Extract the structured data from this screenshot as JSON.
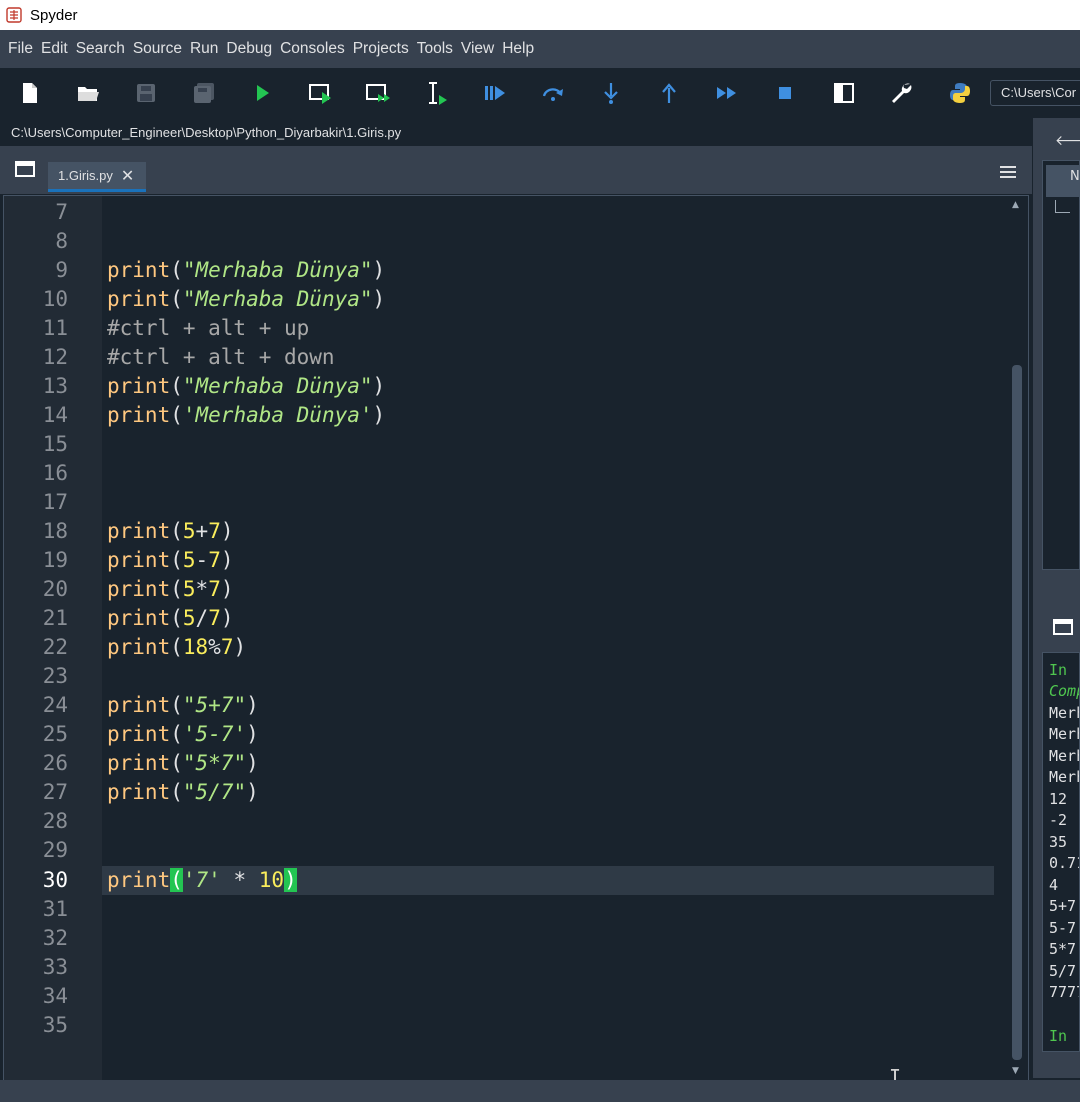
{
  "window": {
    "title": "Spyder"
  },
  "menu": [
    "File",
    "Edit",
    "Search",
    "Source",
    "Run",
    "Debug",
    "Consoles",
    "Projects",
    "Tools",
    "View",
    "Help"
  ],
  "toolbar": {
    "path_value": "C:\\Users\\Computer_Engineer",
    "path_visible": "C:\\Users\\Cor",
    "icons": [
      "new-file-icon",
      "open-file-icon",
      "save-icon",
      "save-all-icon",
      "run-icon",
      "run-cell-icon",
      "run-cell-advance-icon",
      "run-selection-icon",
      "debug-icon",
      "step-over-icon",
      "step-into-icon",
      "step-return-icon",
      "continue-icon",
      "stop-icon",
      "maximize-pane-icon",
      "preferences-icon",
      "python-path-icon"
    ]
  },
  "editor": {
    "file_path": "C:\\Users\\Computer_Engineer\\Desktop\\Python_Diyarbakir\\1.Giris.py",
    "tab_label": "1.Giris.py",
    "current_line": 30,
    "lines": [
      {
        "n": "7"
      },
      {
        "n": "8"
      },
      {
        "n": "9",
        "code": "print(\"Merhaba Dünya\")"
      },
      {
        "n": "10",
        "code": "print(\"Merhaba Dünya\")"
      },
      {
        "n": "11",
        "code": "#ctrl + alt + up"
      },
      {
        "n": "12",
        "code": "#ctrl + alt + down"
      },
      {
        "n": "13",
        "code": "print(\"Merhaba Dünya\")"
      },
      {
        "n": "14",
        "code": "print('Merhaba Dünya')"
      },
      {
        "n": "15"
      },
      {
        "n": "16"
      },
      {
        "n": "17"
      },
      {
        "n": "18",
        "code": "print(5+7)"
      },
      {
        "n": "19",
        "code": "print(5-7)"
      },
      {
        "n": "20",
        "code": "print(5*7)"
      },
      {
        "n": "21",
        "code": "print(5/7)"
      },
      {
        "n": "22",
        "code": "print(18%7)"
      },
      {
        "n": "23"
      },
      {
        "n": "24",
        "code": "print(\"5+7\")"
      },
      {
        "n": "25",
        "code": "print('5-7')"
      },
      {
        "n": "26",
        "code": "print(\"5*7\")"
      },
      {
        "n": "27",
        "code": "print(\"5/7\")"
      },
      {
        "n": "28"
      },
      {
        "n": "29"
      },
      {
        "n": "30",
        "code": "print('7' * 10)"
      },
      {
        "n": "31"
      },
      {
        "n": "32"
      },
      {
        "n": "33"
      },
      {
        "n": "34"
      },
      {
        "n": "35"
      }
    ]
  },
  "right_pane": {
    "header_fragment": "N"
  },
  "console": {
    "lines": [
      "In",
      "Comp",
      "Merh",
      "Merh",
      "Merh",
      "Merh",
      "12",
      "-2",
      "35",
      "0.71",
      "4",
      "5+7",
      "5-7",
      "5*7",
      "5/7",
      "7777",
      "",
      "In"
    ]
  },
  "colors": {
    "background": "#19232d",
    "panel": "#37414f",
    "keyword": "#ffc880",
    "string": "#b0e686",
    "comment": "#a8a8a8",
    "number": "#faed5c",
    "bracket_match": "#23c552",
    "tab_accent": "#1a72bb"
  }
}
